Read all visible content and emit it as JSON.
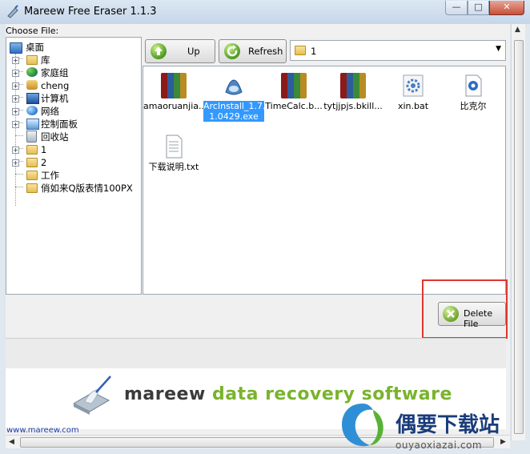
{
  "window": {
    "title": "Mareew Free Eraser 1.1.3",
    "min_glyph": "—",
    "max_glyph": "□",
    "close_glyph": "✕"
  },
  "choose_label": "Choose File:",
  "tree": {
    "items": [
      {
        "label": "桌面"
      },
      {
        "label": "库"
      },
      {
        "label": "家庭组"
      },
      {
        "label": "cheng"
      },
      {
        "label": "计算机"
      },
      {
        "label": "网络"
      },
      {
        "label": "控制面板"
      },
      {
        "label": "回收站"
      },
      {
        "label": "1"
      },
      {
        "label": "2"
      },
      {
        "label": "工作"
      },
      {
        "label": "俏如来Q版表情100PX"
      }
    ]
  },
  "toolbar": {
    "up_label": "Up",
    "refresh_label": "Refresh",
    "path_value": "1"
  },
  "files": [
    {
      "name": "amaoruanjia...",
      "icon": "winrar-archive-icon"
    },
    {
      "name": "ArcInstall_1.7.1.0429.exe",
      "line1": "ArcInstall_1.7.",
      "line2": "1.0429.exe",
      "icon": "installer-icon",
      "selected": true
    },
    {
      "name": "TimeCalc.b...",
      "icon": "winrar-archive-icon"
    },
    {
      "name": "tytjjpjs.bkill...",
      "icon": "winrar-archive-icon"
    },
    {
      "name": "xin.bat",
      "icon": "batch-gear-icon"
    },
    {
      "name": "比克尔",
      "icon": "app-icon"
    },
    {
      "name": "下载说明.txt",
      "icon": "text-document-icon"
    }
  ],
  "delete_label": "Delete File",
  "banner": {
    "brand": "mareew",
    "tagline": "data recovery software",
    "url": "www.mareew.com"
  },
  "watermark": {
    "title": "偶要下载站",
    "subtitle": "ouyaoxiazai.com"
  },
  "colors": {
    "brand_dark": "#3a3a3a",
    "brand_green": "#7ab32e",
    "highlight": "#e0362e",
    "selection": "#3399ff"
  }
}
